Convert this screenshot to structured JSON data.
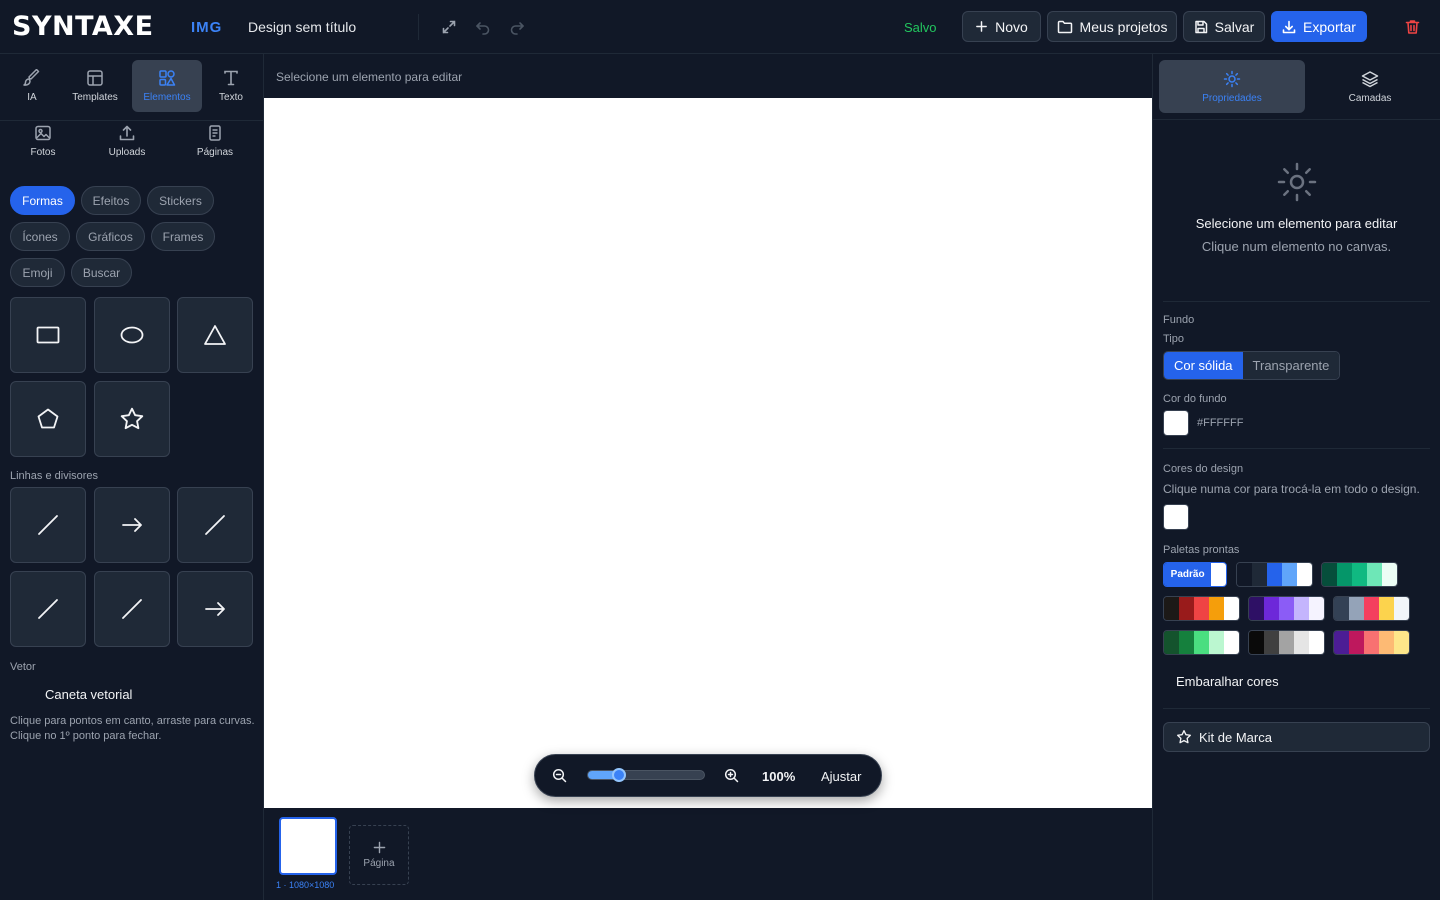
{
  "header": {
    "logo": "SYNTAXE",
    "logo_sub": "IMG",
    "doc_title": "Design sem título",
    "status": "Salvo",
    "buttons": {
      "new": "Novo",
      "projects": "Meus projetos",
      "save": "Salvar",
      "export": "Exportar"
    }
  },
  "left_tools": [
    {
      "label": "IA",
      "icon": "brush-icon"
    },
    {
      "label": "Templates",
      "icon": "template-icon"
    },
    {
      "label": "Elementos",
      "icon": "shapes-icon"
    },
    {
      "label": "Texto",
      "icon": "text-icon"
    },
    {
      "label": "Fotos",
      "icon": "image-icon"
    },
    {
      "label": "Uploads",
      "icon": "upload-icon"
    },
    {
      "label": "Páginas",
      "icon": "pages-icon"
    }
  ],
  "categories": [
    "Formas",
    "Efeitos",
    "Stickers",
    "Ícones",
    "Gráficos",
    "Frames",
    "Emoji",
    "Buscar"
  ],
  "lines_label": "Linhas e divisores",
  "vector": {
    "label": "Vetor",
    "pen": "Caneta vetorial",
    "help1": "Clique para pontos em canto, arraste para curvas.",
    "help2": "Clique no 1º ponto para fechar."
  },
  "canvas": {
    "hint": "Selecione um elemento para editar",
    "zoom": "100%",
    "zoom_fraction": 0.27,
    "fit": "Ajustar",
    "page_label": "1 · 1080×1080",
    "add_page": "Página"
  },
  "right": {
    "tabs": [
      "Propriedades",
      "Camadas"
    ],
    "empty_title": "Selecione um elemento para editar",
    "empty_sub": "Clique num elemento no canvas.",
    "bg_section": "Fundo",
    "type_label": "Tipo",
    "type_options": [
      "Cor sólida",
      "Transparente"
    ],
    "bg_color_label": "Cor do fundo",
    "bg_color_value": "#FFFFFF",
    "design_colors_label": "Cores do design",
    "design_colors_help": "Clique numa cor para trocá-la em todo o design.",
    "palettes_label": "Paletas prontas",
    "default_palette": "Padrão",
    "shuffle": "Embaralhar cores",
    "brand_kit": "Kit de Marca"
  },
  "palettes": [
    [
      "#111827",
      "#1f2937",
      "#2563eb",
      "#60a5fa",
      "#ffffff"
    ],
    [
      "#064e3b",
      "#059669",
      "#10b981",
      "#6ee7b7",
      "#ecfdf5"
    ],
    [
      "#1c1917",
      "#991b1b",
      "#ef4444",
      "#f59e0b",
      "#ffffff"
    ],
    [
      "#2e1065",
      "#6d28d9",
      "#8b5cf6",
      "#c4b5fd",
      "#f5f3ff"
    ],
    [
      "#334155",
      "#94a3b8",
      "#f43f5e",
      "#fcd34d",
      "#f1f5f9"
    ],
    [
      "#14532d",
      "#15803d",
      "#4ade80",
      "#bbf7d0",
      "#ffffff"
    ],
    [
      "#0a0a0a",
      "#404040",
      "#a3a3a3",
      "#e5e5e5",
      "#ffffff"
    ],
    [
      "#4c1d95",
      "#be185d",
      "#f87171",
      "#fdba74",
      "#fde68a"
    ]
  ],
  "colors": {
    "accent": "#2563eb",
    "saved": "#22c55e",
    "danger": "#ef4444"
  }
}
